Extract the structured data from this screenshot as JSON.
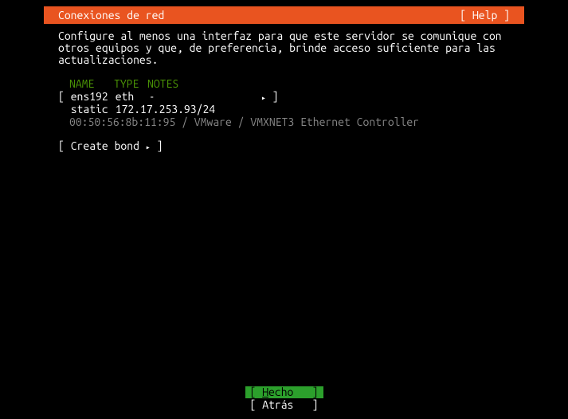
{
  "header": {
    "title": "Conexiones de red",
    "help": "[ Help ]"
  },
  "description": "Configure al menos una interfaz para que este servidor se comunique con otros equipos y que, de preferencia, brinde acceso suficiente para las actualizaciones.",
  "table": {
    "headers": {
      "name": "NAME",
      "type": "TYPE",
      "notes": "NOTES"
    },
    "interface": {
      "open_bracket": "[ ",
      "name": "ens192",
      "type": "eth",
      "notes": "-",
      "arrow": "▸",
      "close_bracket": " ]",
      "addr_label": "static",
      "addr_value": "172.17.253.93/24",
      "hw": "00:50:56:8b:11:95 / VMware / VMXNET3 Ethernet Controller"
    }
  },
  "create_bond": {
    "open": "[ ",
    "label": "Create bond",
    "arrow": "▸",
    "close": " ]"
  },
  "footer": {
    "done": {
      "open": "[ ",
      "label_first": "H",
      "label_rest": "echo",
      "close": "]"
    },
    "back": {
      "open": "[ ",
      "label": "Atrás",
      "close": "]"
    }
  }
}
